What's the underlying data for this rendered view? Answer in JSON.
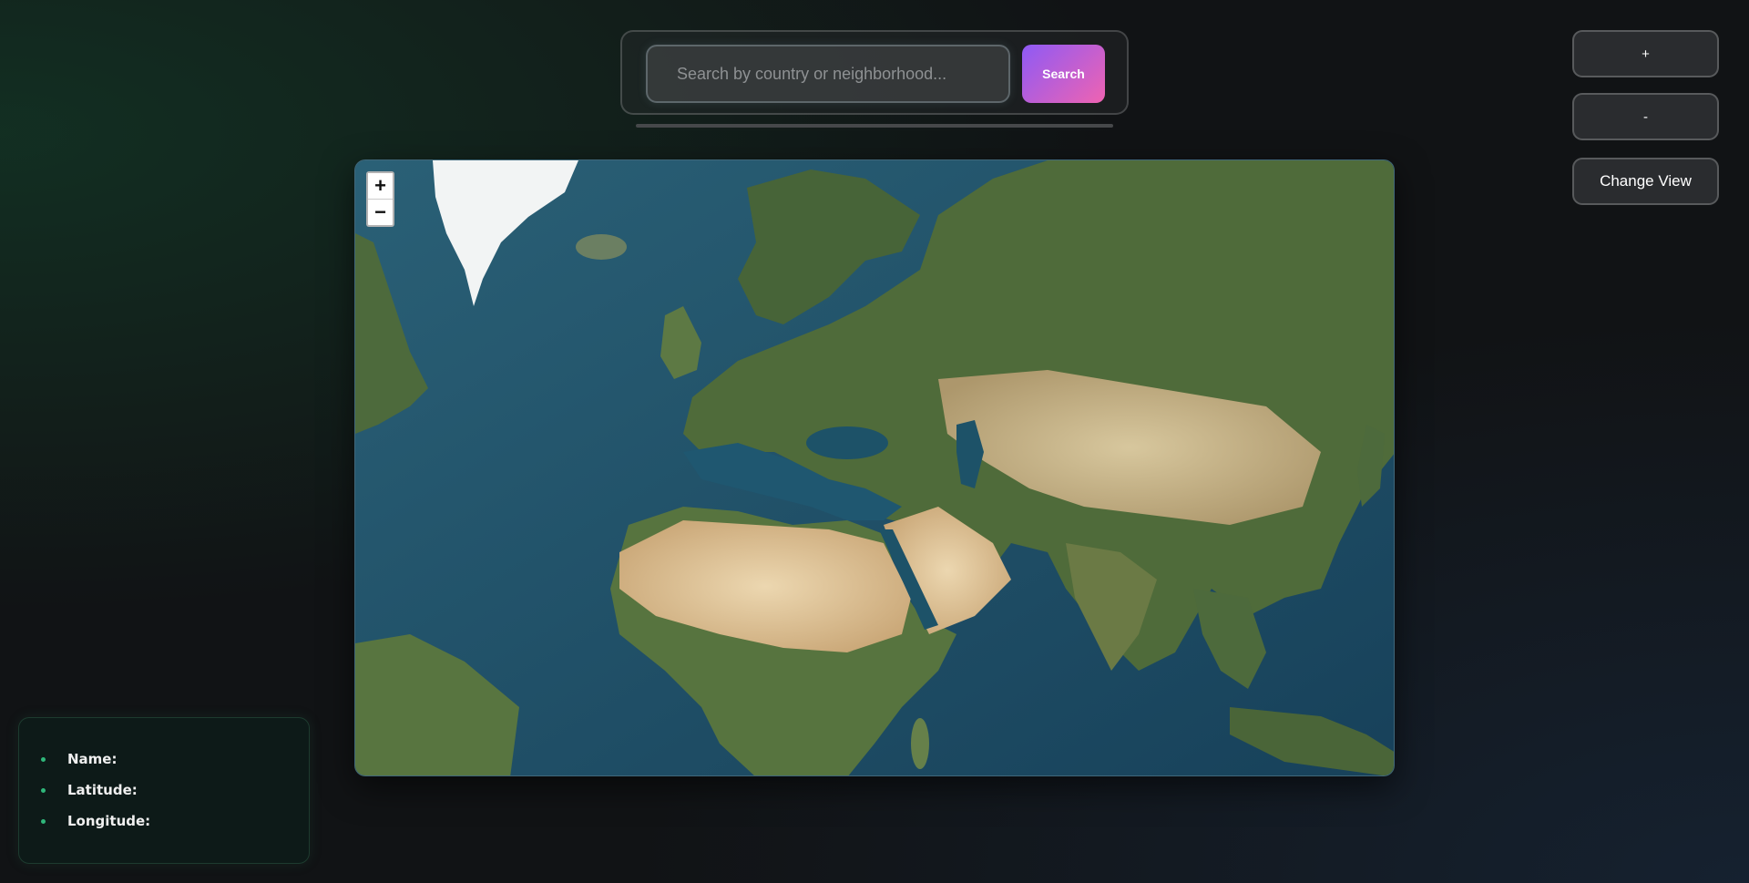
{
  "search": {
    "placeholder": "Search by country or neighborhood...",
    "button_label": "Search"
  },
  "side_controls": {
    "zoom_in_label": "+",
    "zoom_out_label": "-",
    "change_view_label": "Change View"
  },
  "map": {
    "view": "satellite",
    "zoom_in_label": "+",
    "zoom_out_label": "−",
    "colors": {
      "ocean": "#1f4d63",
      "land": "#4f6b3a",
      "desert": "#d8c39a",
      "ice": "#f2f4f4"
    }
  },
  "info": {
    "items": [
      {
        "label": "Name:"
      },
      {
        "label": "Latitude:"
      },
      {
        "label": "Longitude:"
      }
    ]
  },
  "colors": {
    "accent_gradient_start": "#8e5af5",
    "accent_gradient_end": "#ef63b1",
    "bullet": "#2fb67a"
  }
}
